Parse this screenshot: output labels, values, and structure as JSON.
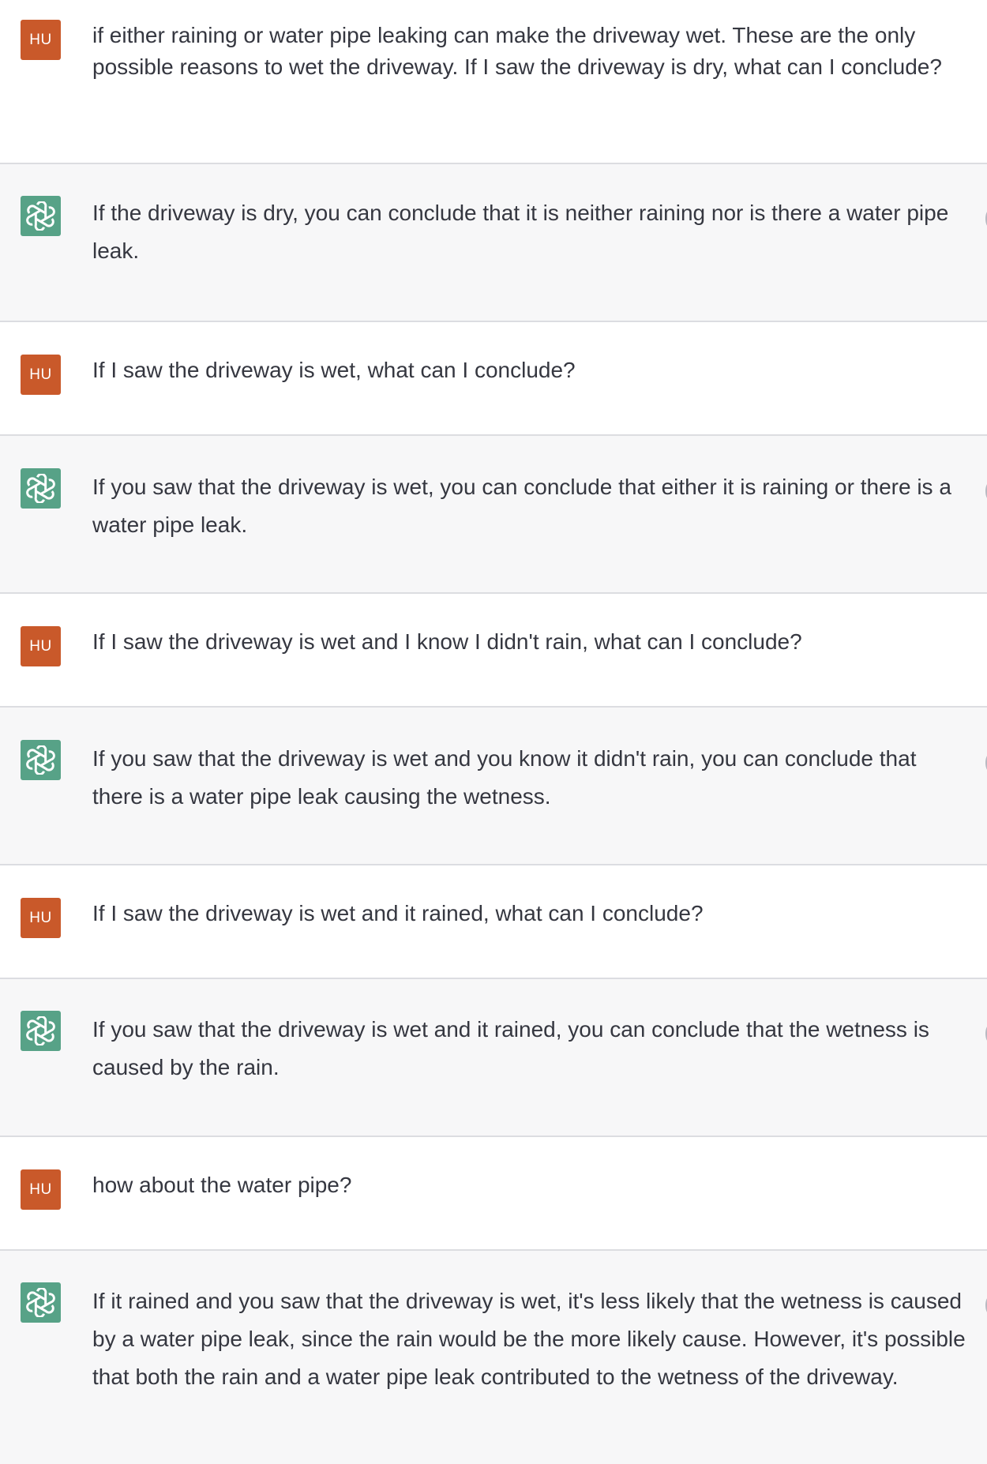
{
  "user_label": "HU",
  "messages": [
    {
      "role": "user",
      "text": "if either raining or water pipe leaking can make the driveway wet. These are the only possible reasons to wet the driveway. If I saw the driveway is dry, what can I conclude?"
    },
    {
      "role": "assistant",
      "text": "If the driveway is dry, you can conclude that it is neither raining nor is there a water pipe leak."
    },
    {
      "role": "user",
      "text": "If I saw the driveway is wet, what can I conclude?"
    },
    {
      "role": "assistant",
      "text": "If you saw that the driveway is wet, you can conclude that either it is raining or there is a water pipe leak."
    },
    {
      "role": "user",
      "text": "If I saw the driveway is wet and I know I didn't rain, what can I conclude?"
    },
    {
      "role": "assistant",
      "text": "If you saw that the driveway is wet and you know it didn't rain, you can conclude that there is a water pipe leak causing the wetness."
    },
    {
      "role": "user",
      "text": "If I saw the driveway is wet and it rained, what can I conclude?"
    },
    {
      "role": "assistant",
      "text": "If you saw that the driveway is wet and it rained, you can conclude that the wetness is caused by the rain."
    },
    {
      "role": "user",
      "text": "how about the water pipe?"
    },
    {
      "role": "assistant",
      "text": "If it rained and you saw that the driveway is wet, it's less likely that the wetness is caused by a water pipe leak, since the rain would be the more likely cause. However, it's possible that both the rain and a water pipe leak contributed to the wetness of the driveway."
    }
  ]
}
